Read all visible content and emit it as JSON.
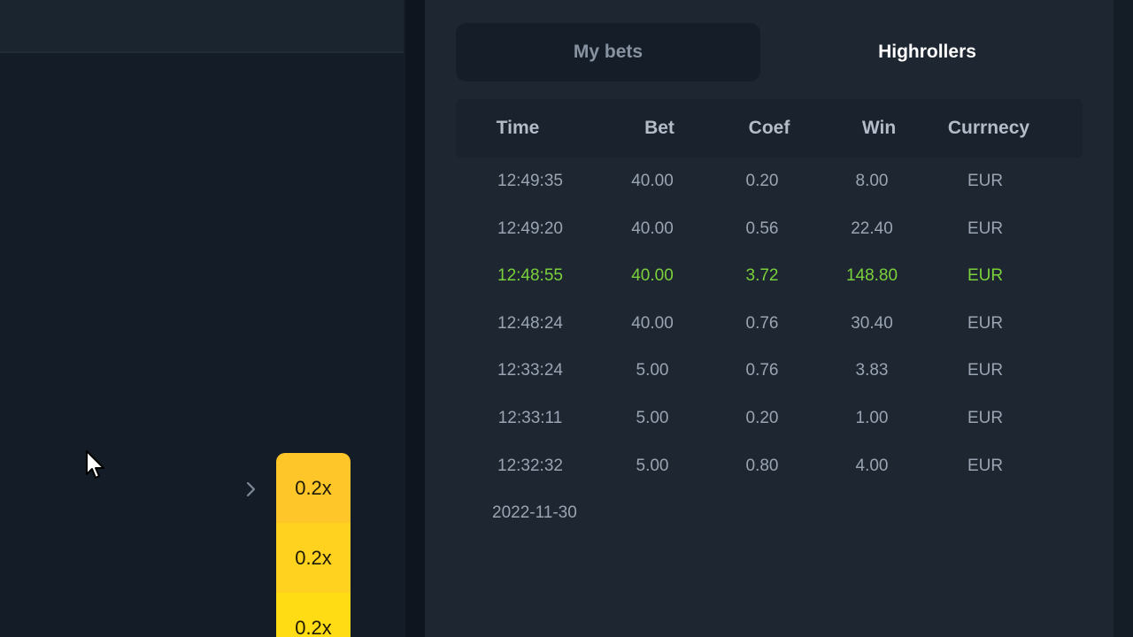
{
  "tabs": {
    "my_bets": "My bets",
    "highrollers": "Highrollers"
  },
  "table": {
    "headers": [
      "Time",
      "Bet",
      "Coef",
      "Win",
      "Currnecy"
    ],
    "rows": [
      {
        "time": "12:49:35",
        "bet": "40.00",
        "coef": "0.20",
        "win": "8.00",
        "currency": "EUR",
        "highlight": false
      },
      {
        "time": "12:49:20",
        "bet": "40.00",
        "coef": "0.56",
        "win": "22.40",
        "currency": "EUR",
        "highlight": false
      },
      {
        "time": "12:48:55",
        "bet": "40.00",
        "coef": "3.72",
        "win": "148.80",
        "currency": "EUR",
        "highlight": true
      },
      {
        "time": "12:48:24",
        "bet": "40.00",
        "coef": "0.76",
        "win": "30.40",
        "currency": "EUR",
        "highlight": false
      },
      {
        "time": "12:33:24",
        "bet": "5.00",
        "coef": "0.76",
        "win": "3.83",
        "currency": "EUR",
        "highlight": false
      },
      {
        "time": "12:33:11",
        "bet": "5.00",
        "coef": "0.20",
        "win": "1.00",
        "currency": "EUR",
        "highlight": false
      },
      {
        "time": "12:32:32",
        "bet": "5.00",
        "coef": "0.80",
        "win": "4.00",
        "currency": "EUR",
        "highlight": false
      }
    ],
    "date_label": "2022-11-30"
  },
  "multipliers": [
    "0.2x",
    "0.2x",
    "0.2x"
  ],
  "colors": {
    "win_green": "#7bd13b",
    "multiplier_yellow": "#ffd21f"
  },
  "icons": {
    "cursor": "mouse-pointer-icon",
    "chevron": "chevron-right-icon"
  }
}
